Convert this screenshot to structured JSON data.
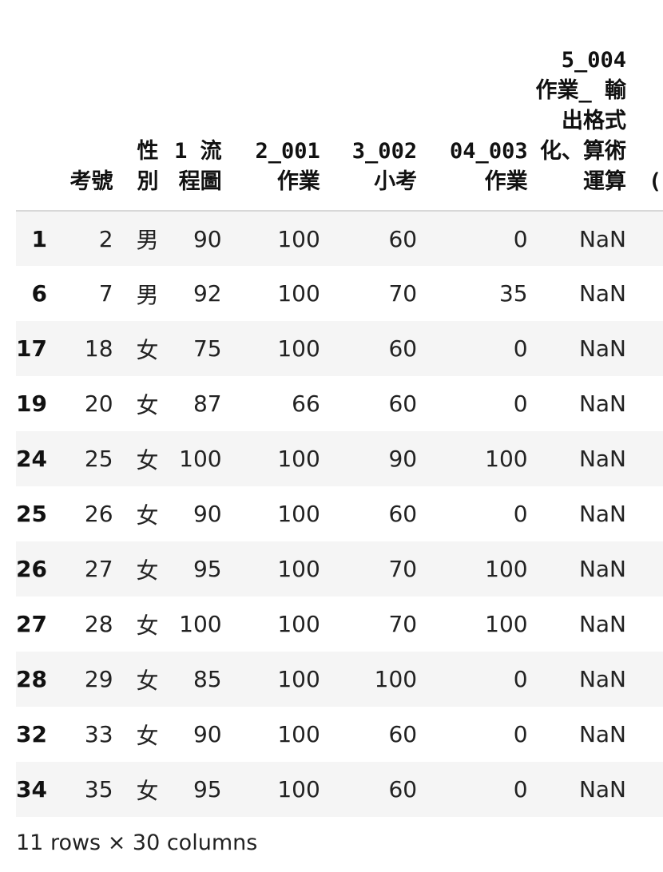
{
  "table": {
    "columns": [
      "",
      "考號",
      "性別",
      "1 流程圖",
      "2_001 作業",
      "3_002 小考",
      "04_003 作業",
      "5_004 作業_ 輸出格式化、算術運算",
      "("
    ],
    "rows": [
      {
        "index": "1",
        "cells": [
          "2",
          "男",
          "90",
          "100",
          "60",
          "0",
          "NaN"
        ]
      },
      {
        "index": "6",
        "cells": [
          "7",
          "男",
          "92",
          "100",
          "70",
          "35",
          "NaN"
        ]
      },
      {
        "index": "17",
        "cells": [
          "18",
          "女",
          "75",
          "100",
          "60",
          "0",
          "NaN"
        ]
      },
      {
        "index": "19",
        "cells": [
          "20",
          "女",
          "87",
          "66",
          "60",
          "0",
          "NaN"
        ]
      },
      {
        "index": "24",
        "cells": [
          "25",
          "女",
          "100",
          "100",
          "90",
          "100",
          "NaN"
        ]
      },
      {
        "index": "25",
        "cells": [
          "26",
          "女",
          "90",
          "100",
          "60",
          "0",
          "NaN"
        ]
      },
      {
        "index": "26",
        "cells": [
          "27",
          "女",
          "95",
          "100",
          "70",
          "100",
          "NaN"
        ]
      },
      {
        "index": "27",
        "cells": [
          "28",
          "女",
          "100",
          "100",
          "70",
          "100",
          "NaN"
        ]
      },
      {
        "index": "28",
        "cells": [
          "29",
          "女",
          "85",
          "100",
          "100",
          "0",
          "NaN"
        ]
      },
      {
        "index": "32",
        "cells": [
          "33",
          "女",
          "90",
          "100",
          "60",
          "0",
          "NaN"
        ]
      },
      {
        "index": "34",
        "cells": [
          "35",
          "女",
          "95",
          "100",
          "60",
          "0",
          "NaN"
        ]
      }
    ]
  },
  "summary": "11 rows × 30 columns",
  "colors": {
    "stripe": "#f5f5f5",
    "header_border": "#d8d8d8"
  }
}
